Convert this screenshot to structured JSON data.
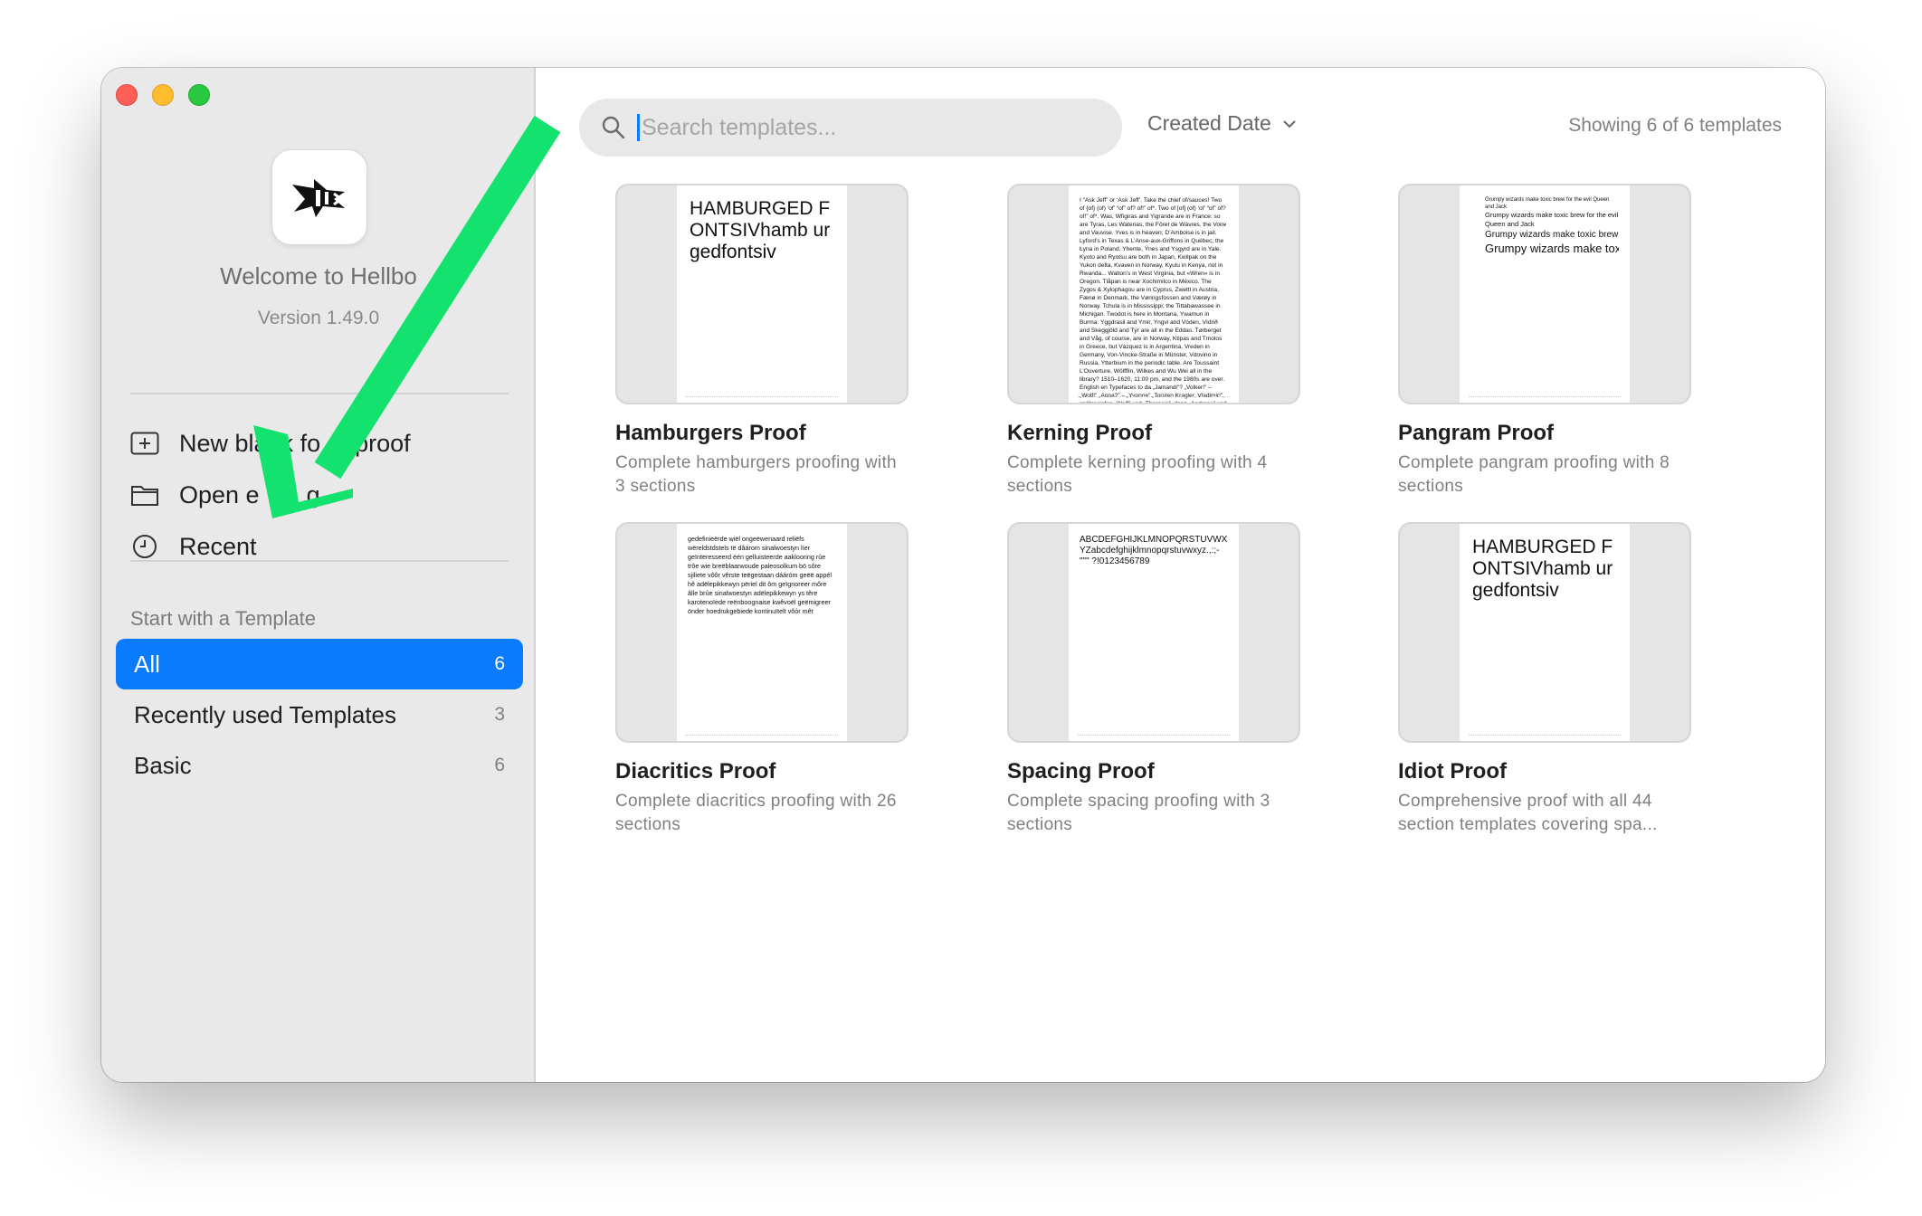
{
  "sidebar": {
    "welcome": "Welcome to Hellbo",
    "version": "Version 1.49.0",
    "actions": [
      {
        "label": "New blank fo",
        "label2": "proof",
        "icon": "plus-square-icon"
      },
      {
        "label": "Open e",
        "label2": "g",
        "icon": "folder-icon"
      },
      {
        "label": "Recent",
        "label2": "",
        "icon": "clock-icon"
      }
    ],
    "section_label": "Start with a Template",
    "categories": [
      {
        "label": "All",
        "count": "6",
        "active": true
      },
      {
        "label": "Recently used Templates",
        "count": "3",
        "active": false
      },
      {
        "label": "Basic",
        "count": "6",
        "active": false
      }
    ]
  },
  "toolbar": {
    "search_placeholder": "Search templates...",
    "sort_label": "Created Date",
    "showing": "Showing 6 of 6 templates"
  },
  "templates": [
    {
      "title": "Hamburgers Proof",
      "desc": "Complete hamburgers proofing with 3 sections",
      "preview": "HAMBURGED FONTSIVhamb urgedfontsiv"
    },
    {
      "title": "Kerning Proof",
      "desc": "Complete kerning proofing with 4 sections",
      "preview": "I “Ask Jeff” or ‘Ask Jeff’. Take the chief of/sauces! Two of {of} (of) ‘of’ “of” of? of!” of*. Two of [of] (of) ‘of’ “of” of? of!” of*. Was, Wfigiras and Yigrande are in France: so are Tyras, Les Waterias, the Fôret de Wàvres, the Voire and Vauvise. Yves is in heaven; D’Amboise is in jail. Lyford’s in Texas & L’Anse-aux-Griffons in Québec; the Łyna in Poland. Yhente, Ýnes and Ysgyrd are in Yale. Kyoto and Ryotsu are both in Japan, Kwilpak on the Yukon delta, Kvaven in Norway, Kyulu in Kenya, not in Rwanda... Walton’s in West Virginia, but «Wren» is in Oregon. Tlåpan is near Xochimilco in México. The Zygos & Xylophagou are in Cyprus, Zwettl in Austria, Fænø in Denmark, the Vøringsfossen and Værøy in Norway. Tchula is in Mississippi; the Tittabawassee in Michigan. Twodot is here in Montana, Ywamun in Burma. Yggdrasil and Ymir, Yngvi and Vóden, Vídrið and Skeggjöld and Týr are all in the Eddas. Tørberget and Våg, of course, are in Norway, Ktipas and Tmolos in Greece, but Vázquez is in Argentina, Vreden in Germany, Von-Vincke-Straße in Münster, Vdovino in Russia, Ytterbium in the periodic table. Are Toussaint L’Ouverture, Wölfflin, Wilkes and Wu Wei all in the library? 1510–1620, 11:00 pm, and the 1980s are over. English en Typefaces to da „Jamandi”? „Volker!” – „Wolf!” „Anna?” – „Yvonne” „Torsten Kragler, Vladimir!”, später riefen „Wolf” und „Theresia”, dann „Andreas” und „Yvonne”! Eleganter ist da »Jamandi!« »Volker!« – »Wolf!« »Anna?« – »Yvonne«."
    },
    {
      "title": "Pangram Proof",
      "desc": "Complete pangram proofing with 8 sections",
      "preview": "Grumpy wizards make toxic brew for the evil Queen and Jack"
    },
    {
      "title": "Diacritics Proof",
      "desc": "Complete diacritics proofing with 26 sections",
      "preview": "gedefinieërde wiël ongeëwenaard reliëfs wëreldstdstels të dåárom sinalwoestyn líer geïnteresseerd één gelluisteerde aaklooring rûe trôe wie breëblaarwoude paleosolkum bö sôre sjiliete vôôr vêrste teëgestaan dááróm geëë appél hê adëlepikkewyn përiel dit ôm geïgnoreer môre âlle brûe sinalwoestyn adëlepikkewyn ys têre karotenoïede reënboognaise kwêvoël geëmigreer önder hoedrukgebiede kontinuïtelt vôór mêt"
    },
    {
      "title": "Spacing Proof",
      "desc": "Complete spacing proofing with 3 sections",
      "preview": "ABCDEFGHIJKLMNOPQRSTUVWXYZabcdefghijklmnopqrstuvwxyz.,:;-\"\"\" ?!0123456789"
    },
    {
      "title": "Idiot Proof",
      "desc": "Comprehensive proof with all 44 section templates covering spa...",
      "preview": "HAMBURGED FONTSIVhamb urgedfontsiv"
    }
  ],
  "colors": {
    "accent": "#0a7bfe",
    "annotation_arrow": "#13e26e"
  }
}
